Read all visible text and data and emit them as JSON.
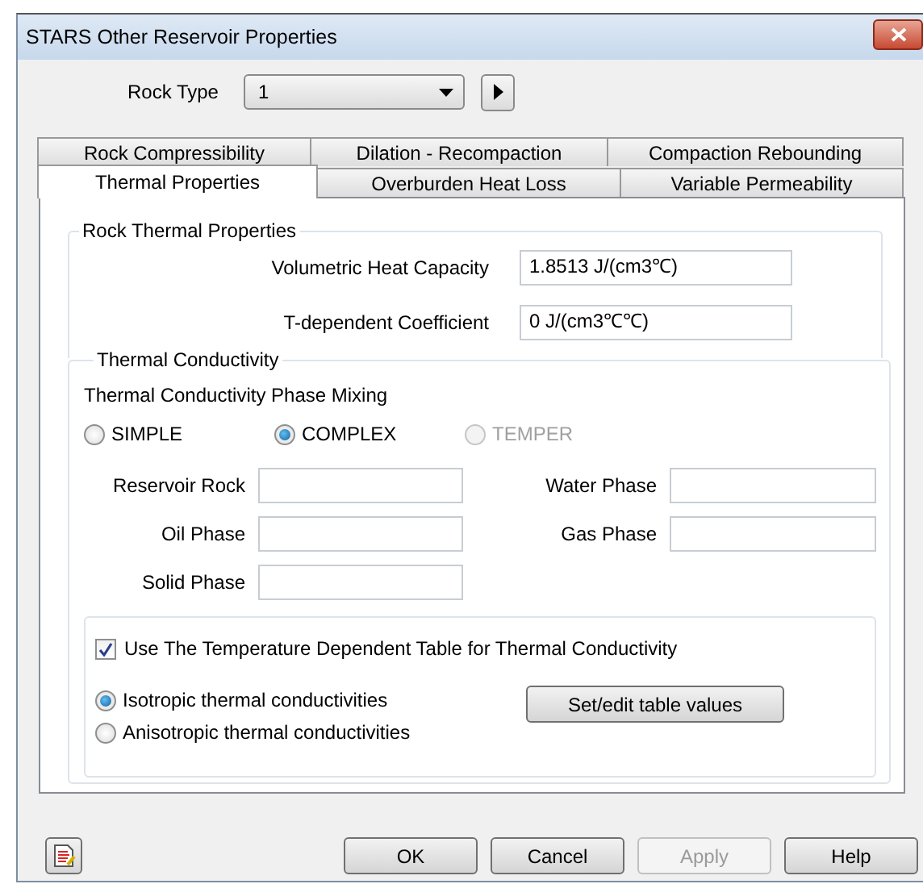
{
  "window": {
    "title": "STARS Other Reservoir Properties"
  },
  "rock_type": {
    "label": "Rock Type",
    "value": "1"
  },
  "tabs_row1": [
    {
      "label": "Rock Compressibility",
      "selected": false
    },
    {
      "label": "Dilation - Recompaction",
      "selected": false
    },
    {
      "label": "Compaction Rebounding",
      "selected": false
    }
  ],
  "tabs_row2": [
    {
      "label": "Thermal Properties",
      "selected": true
    },
    {
      "label": "Overburden Heat Loss",
      "selected": false
    },
    {
      "label": "Variable Permeability",
      "selected": false
    }
  ],
  "rock_thermal": {
    "title": "Rock Thermal Properties",
    "fields": [
      {
        "label": "Volumetric Heat Capacity",
        "value": "1.8513  J/(cm3℃)"
      },
      {
        "label": "T-dependent Coefficient",
        "value": "0  J/(cm3℃℃)"
      }
    ]
  },
  "thermal_conductivity": {
    "title": "Thermal Conductivity",
    "mixing_label": "Thermal Conductivity Phase Mixing",
    "mixing_options": [
      {
        "label": "SIMPLE",
        "selected": false,
        "disabled": false
      },
      {
        "label": "COMPLEX",
        "selected": true,
        "disabled": false
      },
      {
        "label": "TEMPER",
        "selected": false,
        "disabled": true
      }
    ],
    "fields": [
      {
        "label": "Reservoir Rock"
      },
      {
        "label": "Water Phase"
      },
      {
        "label": "Oil Phase"
      },
      {
        "label": "Gas Phase"
      },
      {
        "label": "Solid Phase"
      }
    ],
    "table_option": {
      "label": "Use The Temperature Dependent Table for Thermal Conductivity",
      "checked": true
    },
    "anisotropy_options": [
      {
        "label": "Isotropic thermal conductivities",
        "selected": true
      },
      {
        "label": "Anisotropic thermal conductivities",
        "selected": false
      }
    ],
    "table_button": "Set/edit table values"
  },
  "buttons": [
    {
      "label": "OK",
      "disabled": false
    },
    {
      "label": "Cancel",
      "disabled": false
    },
    {
      "label": "Apply",
      "disabled": true
    },
    {
      "label": "Help",
      "disabled": false
    }
  ]
}
